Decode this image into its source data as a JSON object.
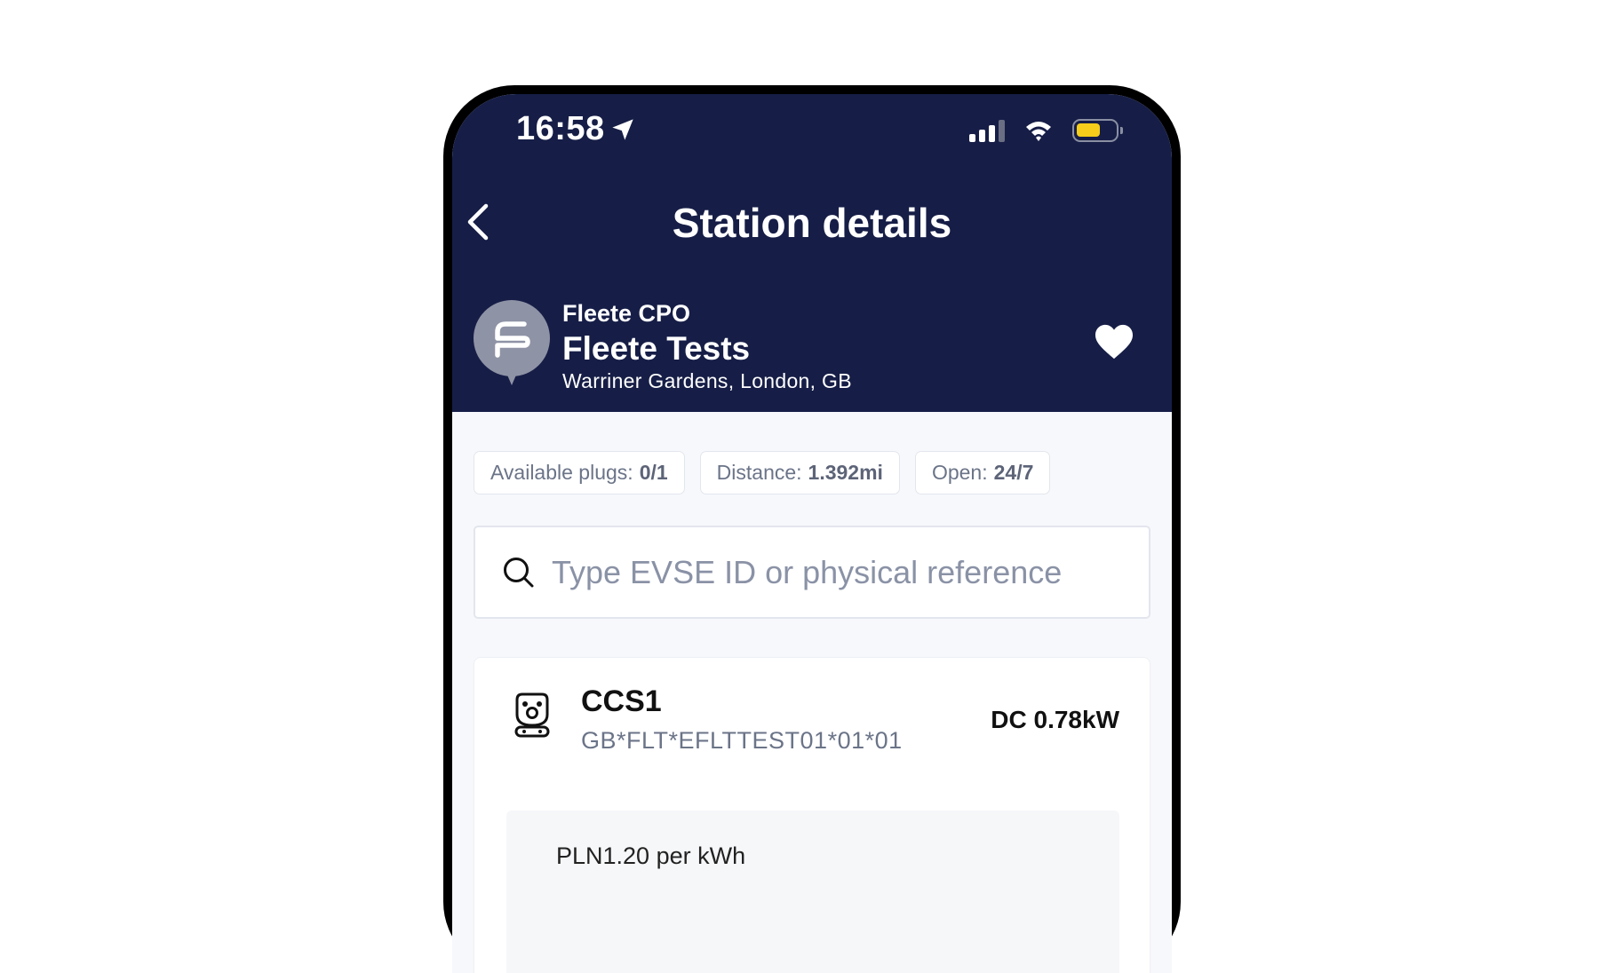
{
  "status_bar": {
    "time": "16:58"
  },
  "header": {
    "title": "Station details",
    "operator": "Fleete CPO",
    "station_name": "Fleete Tests",
    "address": "Warriner Gardens, London, GB"
  },
  "chips": {
    "plugs_label": "Available plugs:",
    "plugs_value": "0/1",
    "distance_label": "Distance:",
    "distance_value": "1.392mi",
    "open_label": "Open:",
    "open_value": "24/7"
  },
  "search": {
    "placeholder": "Type EVSE ID or physical reference"
  },
  "connector_card": {
    "type": "CCS1",
    "evse_id": "GB*FLT*EFLTTEST01*01*01",
    "power": "DC 0.78kW",
    "tariff": "PLN1.20 per kWh"
  },
  "colors": {
    "header_bg": "#161e47",
    "battery": "#f5cd1a",
    "logo_bg": "#8f93a6"
  },
  "icons": [
    "location-arrow-icon",
    "cellular-signal-icon",
    "wifi-icon",
    "battery-icon",
    "chevron-left-icon",
    "station-logo-icon",
    "heart-icon",
    "search-icon",
    "ccs-plug-icon"
  ]
}
